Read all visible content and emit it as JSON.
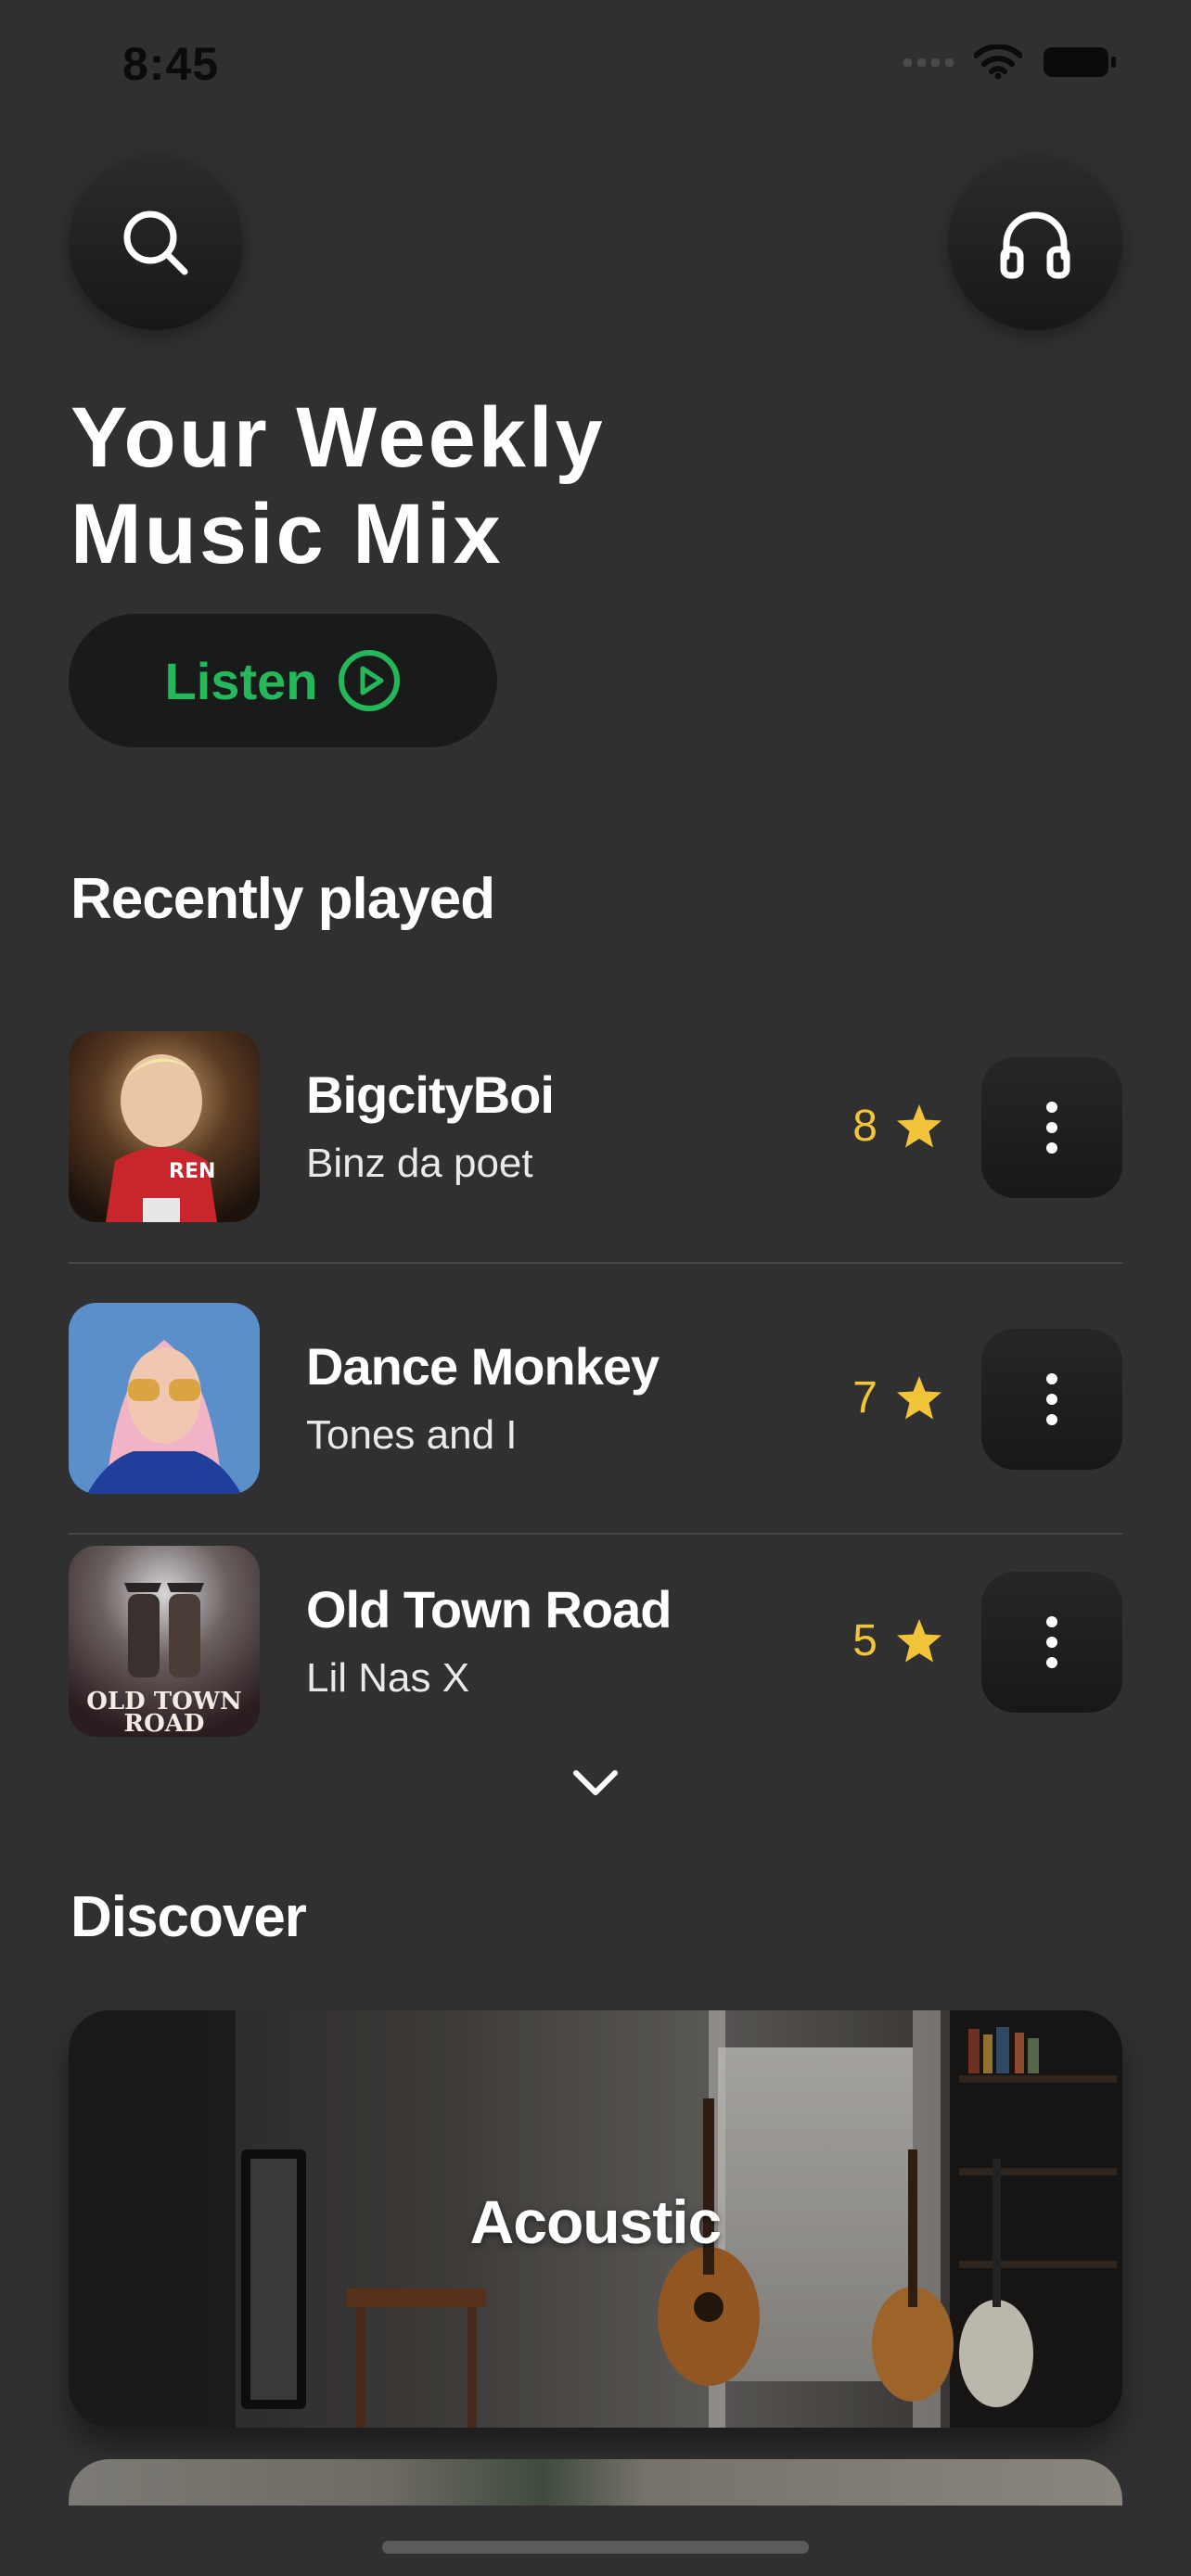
{
  "status_bar": {
    "time": "8:45"
  },
  "header": {
    "title_line1": "Your Weekly",
    "title_line2": "Music Mix",
    "listen_label": "Listen"
  },
  "recently_played": {
    "title": "Recently played",
    "tracks": [
      {
        "title": "BigcityBoi",
        "artist": "Binz da poet",
        "rating": "8"
      },
      {
        "title": "Dance Monkey",
        "artist": "Tones and I",
        "rating": "7"
      },
      {
        "title": "Old Town Road",
        "artist": "Lil Nas X",
        "rating": "5"
      }
    ]
  },
  "discover": {
    "title": "Discover",
    "cards": [
      {
        "label": "Acoustic"
      }
    ]
  },
  "colors": {
    "accent_green": "#25b85a",
    "star_yellow": "#f2c43a",
    "background": "#303030"
  },
  "cover_art": {
    "track3_cover_text_line1": "OLD TOWN",
    "track3_cover_text_line2": "ROAD"
  }
}
